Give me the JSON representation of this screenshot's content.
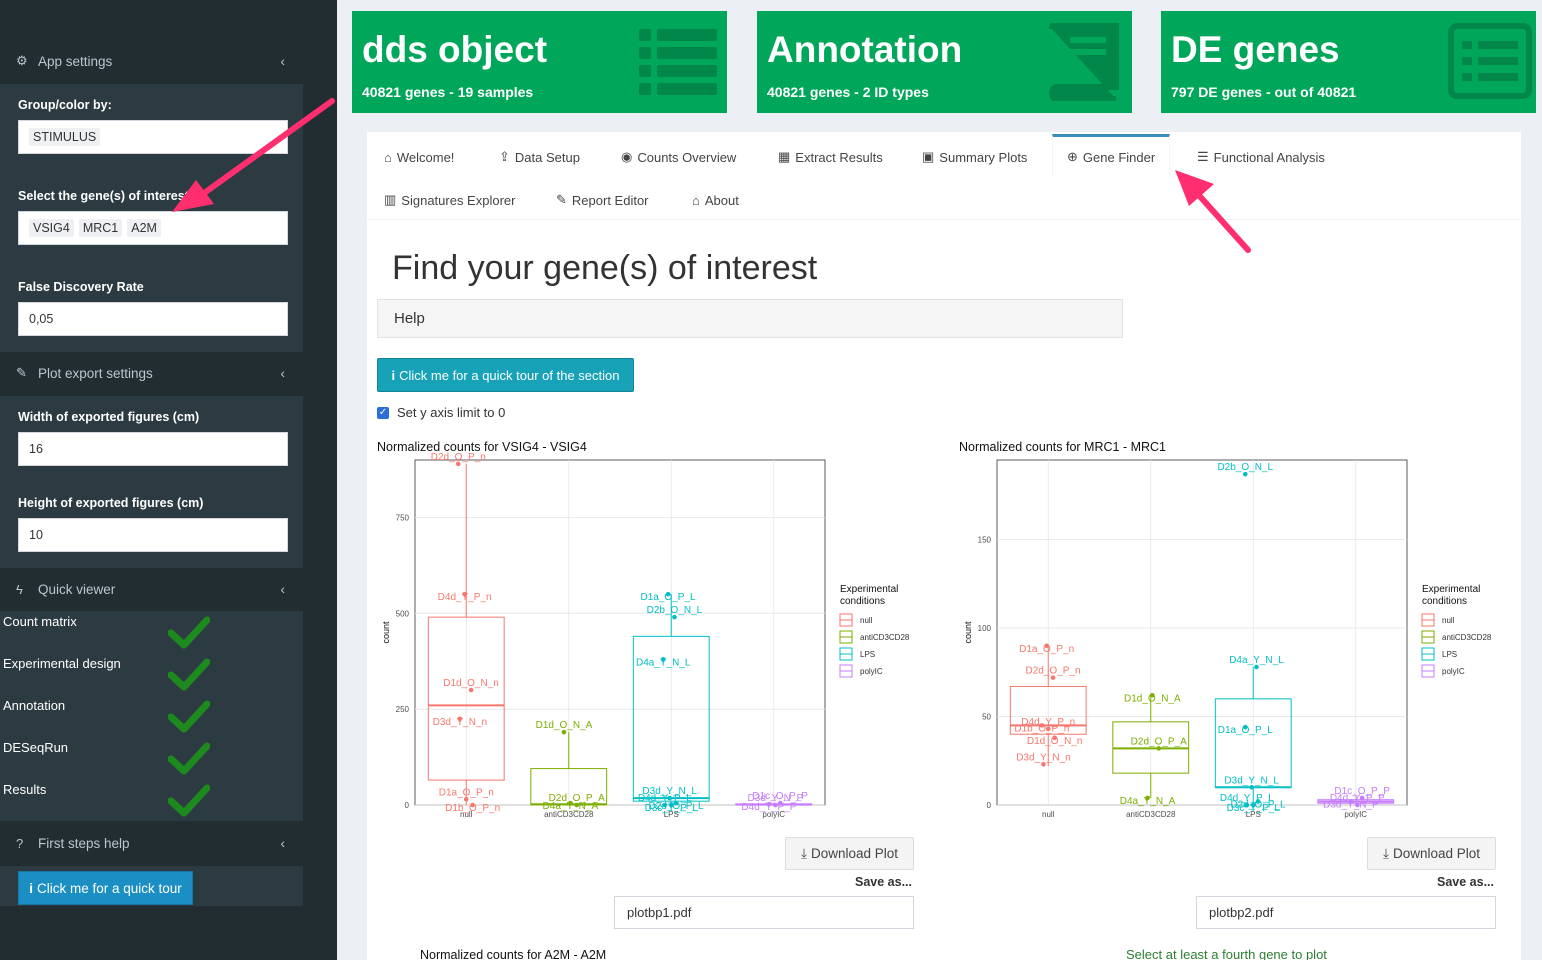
{
  "sidebar": {
    "app_settings": "App settings",
    "group_label": "Group/color by:",
    "group_value": "STIMULUS",
    "genes_label": "Select the gene(s) of interest",
    "genes": [
      "VSIG4",
      "MRC1",
      "A2M"
    ],
    "fdr_label": "False Discovery Rate",
    "fdr_value": "0,05",
    "plot_export": "Plot export settings",
    "width_label": "Width of exported figures (cm)",
    "width_value": "16",
    "height_label": "Height of exported figures (cm)",
    "height_value": "10",
    "quick_viewer": "Quick viewer",
    "qv_items": [
      "Count matrix",
      "Experimental design",
      "Annotation",
      "DESeqRun",
      "Results"
    ],
    "first_steps": "First steps help",
    "tour_button": "Click me for a quick tour"
  },
  "valueboxes": [
    {
      "title": "dds object",
      "subtitle": "40821 genes - 19 samples",
      "icon": "list-icon"
    },
    {
      "title": "Annotation",
      "subtitle": "40821 genes - 2 ID types",
      "icon": "book-icon"
    },
    {
      "title": "DE genes",
      "subtitle": "797 DE genes - out of 40821",
      "icon": "list-alt-icon"
    }
  ],
  "tabs": [
    {
      "label": "Welcome!",
      "icon": "home-icon"
    },
    {
      "label": "Data Setup",
      "icon": "upload-icon"
    },
    {
      "label": "Counts Overview",
      "icon": "eye-icon"
    },
    {
      "label": "Extract Results",
      "icon": "table-icon"
    },
    {
      "label": "Summary Plots",
      "icon": "image-icon"
    },
    {
      "label": "Gene Finder",
      "icon": "crosshairs-icon"
    },
    {
      "label": "Functional Analysis",
      "icon": "list-alt-icon"
    },
    {
      "label": "Signatures Explorer",
      "icon": "map-icon"
    },
    {
      "label": "Report Editor",
      "icon": "pencil-icon"
    },
    {
      "label": "About",
      "icon": "institution-icon"
    }
  ],
  "main": {
    "title": "Find your gene(s) of interest",
    "help": "Help",
    "tour_button": "Click me for a quick tour of the section",
    "ylimit_label": "Set y axis limit to 0",
    "download_label": "Download Plot",
    "save_as": "Save as...",
    "file1": "plotbp1.pdf",
    "file2": "plotbp2.pdf",
    "plot3_title": "Normalized counts for A2M - A2M",
    "fourth_gene_note": "Select at least a fourth gene to plot"
  },
  "colors": {
    "null": "#F8766D",
    "antiCD3CD28": "#7CAE00",
    "LPS": "#00BFC4",
    "polyIC": "#C77CFF"
  },
  "chart_data": [
    {
      "type": "boxplot",
      "title": "Normalized counts for VSIG4 - VSIG4",
      "ylabel": "count",
      "ylim": [
        0,
        900
      ],
      "yticks": [
        0,
        250,
        500,
        750
      ],
      "categories": [
        "null",
        "antiCD3CD28",
        "LPS",
        "polyIC"
      ],
      "legend_title": "Experimental conditions",
      "legend": [
        "null",
        "antiCD3CD28",
        "LPS",
        "polyIC"
      ],
      "boxes": [
        {
          "q1": 65,
          "median": 260,
          "q3": 490,
          "min": 0,
          "max": 890
        },
        {
          "q1": 0,
          "median": 2,
          "q3": 95,
          "min": 0,
          "max": 190
        },
        {
          "q1": 10,
          "median": 18,
          "q3": 440,
          "min": 0,
          "max": 550
        },
        {
          "q1": 0,
          "median": 1,
          "q3": 3,
          "min": 0,
          "max": 5
        }
      ],
      "points": [
        {
          "group": 0,
          "y": 890,
          "label": "D2d_O_P_n"
        },
        {
          "group": 0,
          "y": 550,
          "label": "D4d_Y_P_n"
        },
        {
          "group": 0,
          "y": 300,
          "label": "D1d_O_N_n"
        },
        {
          "group": 0,
          "y": 225,
          "label": "D3d_Y_N_n"
        },
        {
          "group": 0,
          "y": 15,
          "label": "D1a_O_P_n"
        },
        {
          "group": 0,
          "y": 0,
          "label": "D1b_O_P_n"
        },
        {
          "group": 1,
          "y": 190,
          "label": "D1d_O_N_A"
        },
        {
          "group": 1,
          "y": 5,
          "label": "D4a_Y_N_A"
        },
        {
          "group": 1,
          "y": 0,
          "label": "D2d_O_P_A"
        },
        {
          "group": 2,
          "y": 550,
          "label": "D1a_O_P_L"
        },
        {
          "group": 2,
          "y": 490,
          "label": "D2b_O_N_L"
        },
        {
          "group": 2,
          "y": 380,
          "label": "D4a_Y_N_L"
        },
        {
          "group": 2,
          "y": 18,
          "label": "D3d_Y_N_L"
        },
        {
          "group": 2,
          "y": 5,
          "label": "D2d_O_P_L"
        },
        {
          "group": 2,
          "y": 0,
          "label": "D4d_Y_P_L"
        },
        {
          "group": 2,
          "y": 0,
          "label": "D3c_Y_P_L"
        },
        {
          "group": 3,
          "y": 5,
          "label": "D1c_O_P_P"
        },
        {
          "group": 3,
          "y": 2,
          "label": "D4d_Y_P_P"
        },
        {
          "group": 3,
          "y": 0,
          "label": "D3d_Y_N_P"
        }
      ]
    },
    {
      "type": "boxplot",
      "title": "Normalized counts for MRC1 - MRC1",
      "ylabel": "count",
      "ylim": [
        0,
        195
      ],
      "yticks": [
        0,
        50,
        100,
        150
      ],
      "categories": [
        "null",
        "antiCD3CD28",
        "LPS",
        "polyIC"
      ],
      "legend_title": "Experimental conditions",
      "legend": [
        "null",
        "antiCD3CD28",
        "LPS",
        "polyIC"
      ],
      "boxes": [
        {
          "q1": 40,
          "median": 45,
          "q3": 67,
          "min": 22,
          "max": 90
        },
        {
          "q1": 18,
          "median": 32,
          "q3": 47,
          "min": 4,
          "max": 62
        },
        {
          "q1": 10,
          "median": 10,
          "q3": 60,
          "min": 0,
          "max": 78
        },
        {
          "q1": 1,
          "median": 2,
          "q3": 3,
          "min": 0,
          "max": 4
        }
      ],
      "points": [
        {
          "group": 2,
          "y": 187,
          "label": "D2b_O_N_L"
        },
        {
          "group": 0,
          "y": 90,
          "label": "D1a_O_P_n"
        },
        {
          "group": 0,
          "y": 72,
          "label": "D2d_O_P_n"
        },
        {
          "group": 0,
          "y": 45,
          "label": "D1b_O_P_n"
        },
        {
          "group": 0,
          "y": 43,
          "label": "D4d_Y_P_n"
        },
        {
          "group": 0,
          "y": 38,
          "label": "D1d_O_N_n"
        },
        {
          "group": 0,
          "y": 23,
          "label": "D3d_Y_N_n"
        },
        {
          "group": 1,
          "y": 62,
          "label": "D1d_O_N_A"
        },
        {
          "group": 1,
          "y": 32,
          "label": "D2d_O_P_A"
        },
        {
          "group": 1,
          "y": 4,
          "label": "D4a_Y_N_A"
        },
        {
          "group": 2,
          "y": 78,
          "label": "D4a_Y_N_L"
        },
        {
          "group": 2,
          "y": 44,
          "label": "D1a_O_P_L"
        },
        {
          "group": 2,
          "y": 10,
          "label": "D3d_Y_N_L"
        },
        {
          "group": 2,
          "y": 2,
          "label": "D2d_O_P_L"
        },
        {
          "group": 2,
          "y": 0,
          "label": "D4d_Y_P_L"
        },
        {
          "group": 2,
          "y": 0,
          "label": "D3c_Y_P_L"
        },
        {
          "group": 3,
          "y": 4,
          "label": "D1c_O_P_P"
        },
        {
          "group": 3,
          "y": 2,
          "label": "D3d_Y_N_P"
        },
        {
          "group": 3,
          "y": 0,
          "label": "D4d_Y_P_P"
        }
      ]
    }
  ]
}
